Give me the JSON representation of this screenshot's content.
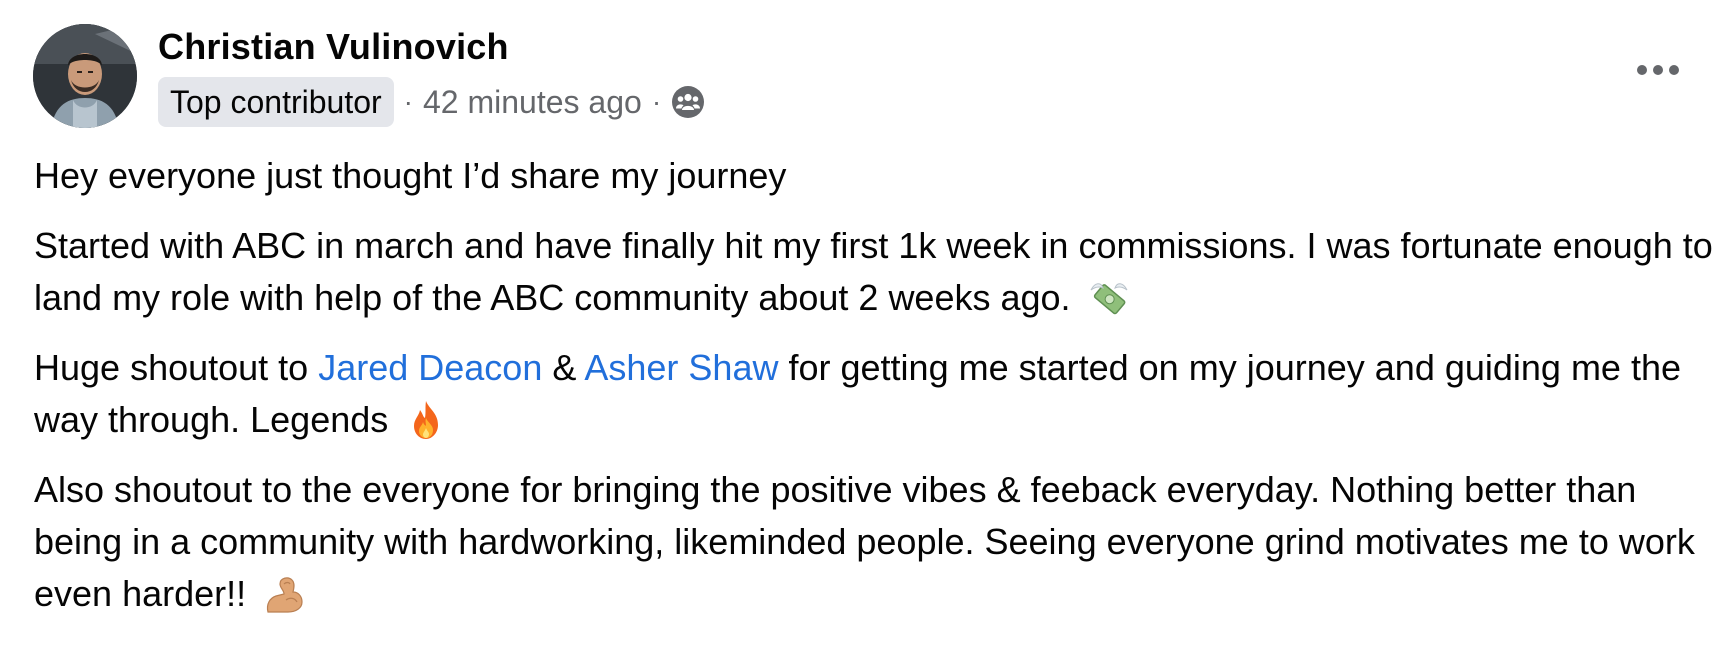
{
  "post": {
    "author": {
      "name": "Christian Vulinovich",
      "badge": "Top contributor"
    },
    "meta": {
      "separator": "·",
      "timestamp": "42 minutes ago",
      "audience_icon": "group-audience-icon"
    },
    "more_icon": "more-options-icon",
    "paragraphs": {
      "p1": {
        "text": "Hey everyone just thought I’d share my journey"
      },
      "p2": {
        "text": "Started with ABC in march and have finally hit my first 1k week in commissions. I was fortunate enough to land my role with help of the ABC community about 2 weeks ago.",
        "emoji": "money-with-wings-emoji"
      },
      "p3": {
        "before": "Huge shoutout to ",
        "mention1": "Jared Deacon",
        "between": " & ",
        "mention2": "Asher Shaw",
        "after": " for getting me started on my journey and guiding me the way through. Legends",
        "emoji": "fire-emoji"
      },
      "p4": {
        "text": "Also shoutout to the everyone for bringing the positive vibes & feeback everyday. Nothing better than being in a community with hardworking, likeminded people. Seeing everyone grind motivates me to work even harder!!",
        "emoji": "flexed-biceps-emoji"
      }
    },
    "colors": {
      "text": "#050505",
      "secondary_text": "#65676b",
      "badge_bg": "#e4e6eb",
      "mention": "#216fdb"
    }
  }
}
